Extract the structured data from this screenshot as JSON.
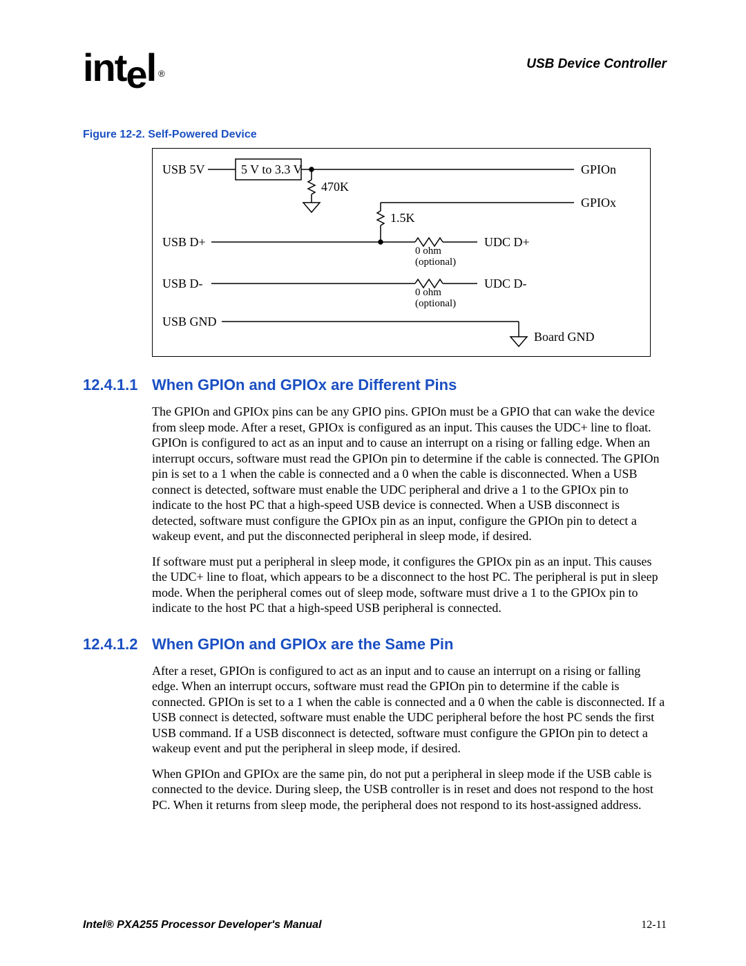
{
  "header": {
    "logo_text": "intel",
    "logo_reg": "®",
    "section_title": "USB Device Controller"
  },
  "figure": {
    "caption": "Figure 12-2. Self-Powered Device",
    "labels": {
      "usb5v": "USB 5V",
      "regulator": "5 V to 3.3 V",
      "r470k": "470K",
      "r1_5k": "1.5K",
      "usb_dp": "USB D+",
      "usb_dm": "USB D-",
      "usb_gnd": "USB GND",
      "gpion": "GPIOn",
      "gpiox": "GPIOx",
      "udc_dp": "UDC D+",
      "udc_dm": "UDC D-",
      "board_gnd": "Board GND",
      "r0_1": "0 ohm",
      "opt_1": "(optional)",
      "r0_2": "0 ohm",
      "opt_2": "(optional)"
    }
  },
  "sections": [
    {
      "num": "12.4.1.1",
      "title": "When GPIOn and GPIOx are Different Pins",
      "paragraphs": [
        "The GPIOn and GPIOx pins can be any GPIO pins. GPIOn must be a GPIO that can wake the device from sleep mode. After a reset, GPIOx is configured as an input. This causes the UDC+ line to float. GPIOn is configured to act as an input and to cause an interrupt on a rising or falling edge. When an interrupt occurs, software must read the GPIOn pin to determine if the cable is connected. The GPIOn pin is set to a 1 when the cable is connected and a 0 when the cable is disconnected. When a USB connect is detected, software must enable the UDC peripheral and drive a 1 to the GPIOx pin to indicate to the host PC that a high-speed USB device is connected. When a USB disconnect is detected, software must configure the GPIOx pin as an input, configure the GPIOn pin to detect a wakeup event, and put the disconnected peripheral in sleep mode, if desired.",
        "If software must put a peripheral in sleep mode, it configures the GPIOx pin as an input. This causes the UDC+ line to float, which appears to be a disconnect to the host PC. The peripheral is put in sleep mode. When the peripheral comes out of sleep mode, software must drive a 1 to the GPIOx pin to indicate to the host PC that a high-speed USB peripheral is connected."
      ]
    },
    {
      "num": "12.4.1.2",
      "title": "When GPIOn and GPIOx are the Same Pin",
      "paragraphs": [
        "After a reset, GPIOn is configured to act as an input and to cause an interrupt on a rising or falling edge. When an interrupt occurs, software must read the GPIOn pin to determine if the cable is connected. GPIOn is set to a 1 when the cable is connected and a 0 when the cable is disconnected. If a USB connect is detected, software must enable the UDC peripheral before the host PC sends the first USB command. If a USB disconnect is detected, software must configure the GPIOn pin to detect a wakeup event and put the peripheral in sleep mode, if desired.",
        "When GPIOn and GPIOx are the same pin, do not put a peripheral in sleep mode if the USB cable is connected to the device. During sleep, the USB controller is in reset and does not respond to the host PC. When it returns from sleep mode, the peripheral does not respond to its host-assigned address."
      ]
    }
  ],
  "footer": {
    "manual": "Intel® PXA255 Processor Developer's Manual",
    "page": "12-11"
  }
}
